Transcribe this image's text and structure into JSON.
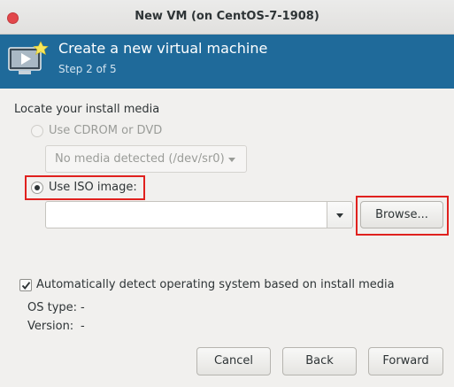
{
  "window": {
    "title": "New VM (on CentOS-7-1908)"
  },
  "header": {
    "title": "Create a new virtual machine",
    "step": "Step 2 of 5"
  },
  "install_media": {
    "section_label": "Locate your install media",
    "cdrom_option": "Use CDROM or DVD",
    "cdrom_dropdown_value": "No media detected (/dev/sr0)",
    "iso_option": "Use ISO image:",
    "iso_path_value": "",
    "browse_label": "Browse..."
  },
  "os_detection": {
    "auto_detect_label": "Automatically detect operating system based on install media",
    "auto_detect_checked": true,
    "os_type_label": "OS type:",
    "os_type_value": "-",
    "version_label": "Version:",
    "version_value": "-"
  },
  "footer": {
    "cancel_label": "Cancel",
    "back_label": "Back",
    "forward_label": "Forward"
  },
  "colors": {
    "banner": "#1f6a9a",
    "highlight_box": "#e0211e",
    "close_button": "#e2474b"
  },
  "icons": [
    "close-icon",
    "virtual-machine-icon",
    "chevron-down-icon",
    "checkmark-icon"
  ]
}
